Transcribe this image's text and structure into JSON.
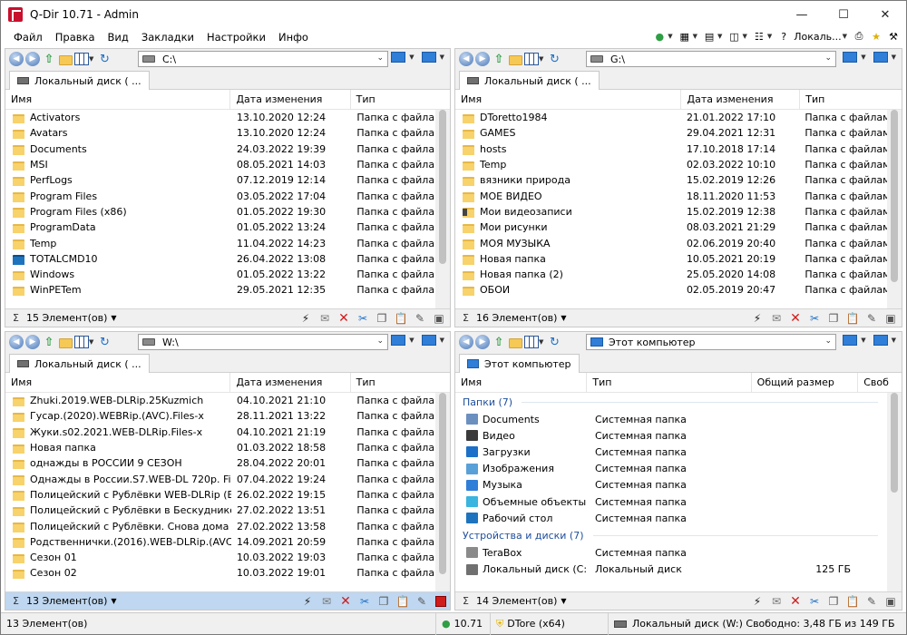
{
  "window": {
    "title": "Q-Dir 10.71 - Admin"
  },
  "menu": [
    "Файл",
    "Правка",
    "Вид",
    "Закладки",
    "Настройки",
    "Инфо"
  ],
  "topbar": {
    "local_label": "Локаль..."
  },
  "panes": {
    "top_left": {
      "address": "C:\\",
      "tab_label": "Локальный диск ( ...",
      "columns": [
        "Имя",
        "Дата изменения",
        "Тип"
      ],
      "rows": [
        {
          "name": "Activators",
          "date": "13.10.2020 12:24",
          "type": "Папка с файлами",
          "icon": "folder"
        },
        {
          "name": "Avatars",
          "date": "13.10.2020 12:24",
          "type": "Папка с файлами",
          "icon": "folder"
        },
        {
          "name": "Documents",
          "date": "24.03.2022 19:39",
          "type": "Папка с файлами",
          "icon": "folder"
        },
        {
          "name": "MSI",
          "date": "08.05.2021 14:03",
          "type": "Папка с файлами",
          "icon": "folder"
        },
        {
          "name": "PerfLogs",
          "date": "07.12.2019 12:14",
          "type": "Папка с файлами",
          "icon": "folder"
        },
        {
          "name": "Program Files",
          "date": "03.05.2022 17:04",
          "type": "Папка с файлами",
          "icon": "folder"
        },
        {
          "name": "Program Files (x86)",
          "date": "01.05.2022 19:30",
          "type": "Папка с файлами",
          "icon": "folder"
        },
        {
          "name": "ProgramData",
          "date": "01.05.2022 13:24",
          "type": "Папка с файлами",
          "icon": "folder"
        },
        {
          "name": "Temp",
          "date": "11.04.2022 14:23",
          "type": "Папка с файлами",
          "icon": "folder"
        },
        {
          "name": "TOTALCMD10",
          "date": "26.04.2022 13:08",
          "type": "Папка с файлами",
          "icon": "exe"
        },
        {
          "name": "Windows",
          "date": "01.05.2022 13:22",
          "type": "Папка с файлами",
          "icon": "folder"
        },
        {
          "name": "WinPETem",
          "date": "29.05.2021 12:35",
          "type": "Папка с файлами",
          "icon": "folder"
        }
      ],
      "status": "15 Элемент(ов)"
    },
    "top_right": {
      "address": "G:\\",
      "tab_label": "Локальный диск ( ...",
      "columns": [
        "Имя",
        "Дата изменения",
        "Тип"
      ],
      "rows": [
        {
          "name": "DToretto1984",
          "date": "21.01.2022 17:10",
          "type": "Папка с файлами",
          "icon": "folder"
        },
        {
          "name": "GAMES",
          "date": "29.04.2021 12:31",
          "type": "Папка с файлами",
          "icon": "folder"
        },
        {
          "name": "hosts",
          "date": "17.10.2018 17:14",
          "type": "Папка с файлами",
          "icon": "folder"
        },
        {
          "name": "Temp",
          "date": "02.03.2022 10:10",
          "type": "Папка с файлами",
          "icon": "folder"
        },
        {
          "name": "вязники природа",
          "date": "15.02.2019 12:26",
          "type": "Папка с файлами",
          "icon": "folder"
        },
        {
          "name": "МОЕ ВИДЕО",
          "date": "18.11.2020 11:53",
          "type": "Папка с файлами",
          "icon": "folder"
        },
        {
          "name": "Мои видеозаписи",
          "date": "15.02.2019 12:38",
          "type": "Папка с файлами",
          "icon": "video"
        },
        {
          "name": "Мои рисунки",
          "date": "08.03.2021 21:29",
          "type": "Папка с файлами",
          "icon": "folder"
        },
        {
          "name": "МОЯ МУЗЫКА",
          "date": "02.06.2019 20:40",
          "type": "Папка с файлами",
          "icon": "folder"
        },
        {
          "name": "Новая папка",
          "date": "10.05.2021 20:19",
          "type": "Папка с файлами",
          "icon": "folder"
        },
        {
          "name": "Новая папка (2)",
          "date": "25.05.2020 14:08",
          "type": "Папка с файлами",
          "icon": "folder"
        },
        {
          "name": "ОБОИ",
          "date": "02.05.2019 20:47",
          "type": "Папка с файлами",
          "icon": "folder"
        }
      ],
      "status": "16 Элемент(ов)"
    },
    "bottom_left": {
      "address": "W:\\",
      "tab_label": "Локальный диск ( ...",
      "columns": [
        "Имя",
        "Дата изменения",
        "Тип"
      ],
      "rows": [
        {
          "name": "Zhuki.2019.WEB-DLRip.25Kuzmich",
          "date": "04.10.2021 21:10",
          "type": "Папка с файлами",
          "icon": "folder"
        },
        {
          "name": "Гусар.(2020).WEBRip.(AVC).Files-x",
          "date": "28.11.2021 13:22",
          "type": "Папка с файлами",
          "icon": "folder"
        },
        {
          "name": "Жуки.s02.2021.WEB-DLRip.Files-x",
          "date": "04.10.2021 21:19",
          "type": "Папка с файлами",
          "icon": "folder"
        },
        {
          "name": "Новая папка",
          "date": "01.03.2022 18:58",
          "type": "Папка с файлами",
          "icon": "folder"
        },
        {
          "name": "однажды в РОССИИ 9 СЕЗОН",
          "date": "28.04.2022 20:01",
          "type": "Папка с файлами",
          "icon": "folder"
        },
        {
          "name": "Однажды в России.S7.WEB-DL 720p. Files-x",
          "date": "07.04.2022 19:24",
          "type": "Папка с файлами",
          "icon": "folder"
        },
        {
          "name": "Полицейский с Рублёвки WEB-DLRip (Вер...",
          "date": "26.02.2022 19:15",
          "type": "Папка с файлами",
          "icon": "folder"
        },
        {
          "name": "Полицейский с Рублёвки в Бескудниково ...",
          "date": "27.02.2022 13:51",
          "type": "Папка с файлами",
          "icon": "folder"
        },
        {
          "name": "Полицейский с Рублёвки. Снова дома WE...",
          "date": "27.02.2022 13:58",
          "type": "Папка с файлами",
          "icon": "folder"
        },
        {
          "name": "Родственнички.(2016).WEB-DLRip.(AVC).Fil...",
          "date": "14.09.2021 20:59",
          "type": "Папка с файлами",
          "icon": "folder"
        },
        {
          "name": "Сезон 01",
          "date": "10.03.2022 19:03",
          "type": "Папка с файлами",
          "icon": "folder"
        },
        {
          "name": "Сезон 02",
          "date": "10.03.2022 19:01",
          "type": "Папка с файлами",
          "icon": "folder"
        }
      ],
      "status": "13 Элемент(ов)"
    },
    "bottom_right": {
      "address": "Этот компьютер",
      "tab_label": "Этот компьютер",
      "columns": [
        "Имя",
        "Тип",
        "Общий размер",
        "Своб"
      ],
      "group_folders": "Папки (7)",
      "folders": [
        {
          "name": "Documents",
          "type": "Системная папка",
          "color": "#6b8fbf"
        },
        {
          "name": "Видео",
          "type": "Системная папка",
          "color": "#3a3a3a"
        },
        {
          "name": "Загрузки",
          "type": "Системная папка",
          "color": "#1c70c8"
        },
        {
          "name": "Изображения",
          "type": "Системная папка",
          "color": "#5aa0d8"
        },
        {
          "name": "Музыка",
          "type": "Системная папка",
          "color": "#2f7ed8"
        },
        {
          "name": "Объемные объекты",
          "type": "Системная папка",
          "color": "#39b5e0"
        },
        {
          "name": "Рабочий стол",
          "type": "Системная папка",
          "color": "#1e73be"
        }
      ],
      "group_devices": "Устройства и диски (7)",
      "devices": [
        {
          "name": "TeraBox",
          "type": "Системная папка",
          "size": "",
          "color": "#8a8a8a"
        },
        {
          "name": "Локальный диск (C:)",
          "type": "Локальный диск",
          "size": "125 ГБ",
          "color": "#707070"
        }
      ],
      "status": "14 Элемент(ов)"
    }
  },
  "bottombar": {
    "count": "13 Элемент(ов)",
    "version": "10.71",
    "user": "DTore (x64)",
    "disk_info": "Локальный диск (W:) Свободно: 3,48 ГБ из 149 ГБ"
  }
}
